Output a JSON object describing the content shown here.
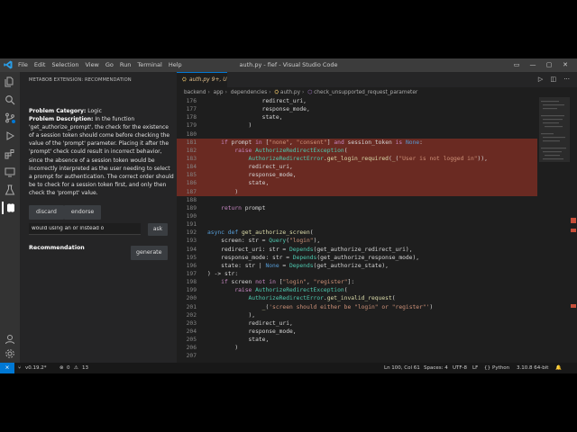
{
  "titlebar": {
    "menu": [
      "File",
      "Edit",
      "Selection",
      "View",
      "Go",
      "Run",
      "Terminal",
      "Help"
    ],
    "title": "auth.py - fief - Visual Studio Code"
  },
  "sidebar": {
    "header": "METABOB EXTENSION: RECOMMENDATION",
    "category_label": "Problem Category:",
    "category_value": "Logic",
    "description_label": "Problem Description:",
    "description_text": "In the function 'get_authorize_prompt', the check for the existence of a session token should come before checking the value of the 'prompt' parameter. Placing it after the 'prompt' check could result in incorrect behavior, since the absence of a session token would be incorrectly interpreted as the user needing to select a prompt for authentication. The correct order should be to check for a session token first, and only then check the 'prompt' value.",
    "discard_label": "discard",
    "endorse_label": "endorse",
    "ask_input_value": "would using an or instead o",
    "ask_label": "ask",
    "recommendation_label": "Recommendation",
    "generate_label": "generate"
  },
  "editor": {
    "tab": {
      "icon": "py-file-icon",
      "label": "auth.py",
      "status": "9+, U"
    },
    "breadcrumb": [
      "backend",
      "app",
      "dependencies",
      "auth.py",
      "check_unsupported_request_parameter"
    ],
    "lines": [
      {
        "n": "176",
        "t": "                redirect_uri,",
        "hl": false
      },
      {
        "n": "177",
        "t": "                response_mode,",
        "hl": false
      },
      {
        "n": "178",
        "t": "                state,",
        "hl": false
      },
      {
        "n": "179",
        "t": "            )",
        "hl": false
      },
      {
        "n": "180",
        "t": "",
        "hl": false
      },
      {
        "n": "181",
        "t": "    if prompt in [\"none\", \"consent\"] and session_token is None:",
        "hl": true
      },
      {
        "n": "182",
        "t": "        raise AuthorizeRedirectException(",
        "hl": true
      },
      {
        "n": "183",
        "t": "            AuthorizeRedirectError.get_login_required(_(\"User is not logged in\")),",
        "hl": true
      },
      {
        "n": "184",
        "t": "            redirect_uri,",
        "hl": true
      },
      {
        "n": "185",
        "t": "            response_mode,",
        "hl": true
      },
      {
        "n": "186",
        "t": "            state,",
        "hl": true
      },
      {
        "n": "187",
        "t": "        )",
        "hl": true
      },
      {
        "n": "188",
        "t": "",
        "hl": false
      },
      {
        "n": "189",
        "t": "    return prompt",
        "hl": false
      },
      {
        "n": "190",
        "t": "",
        "hl": false
      },
      {
        "n": "191",
        "t": "",
        "hl": false
      },
      {
        "n": "192",
        "t": "async def get_authorize_screen(",
        "hl": false
      },
      {
        "n": "193",
        "t": "    screen: str = Query(\"login\"),",
        "hl": false
      },
      {
        "n": "194",
        "t": "    redirect_uri: str = Depends(get_authorize_redirect_uri),",
        "hl": false
      },
      {
        "n": "195",
        "t": "    response_mode: str = Depends(get_authorize_response_mode),",
        "hl": false
      },
      {
        "n": "196",
        "t": "    state: str | None = Depends(get_authorize_state),",
        "hl": false
      },
      {
        "n": "197",
        "t": ") -> str:",
        "hl": false
      },
      {
        "n": "198",
        "t": "    if screen not in [\"login\", \"register\"]:",
        "hl": false
      },
      {
        "n": "199",
        "t": "        raise AuthorizeRedirectException(",
        "hl": false
      },
      {
        "n": "200",
        "t": "            AuthorizeRedirectError.get_invalid_request(",
        "hl": false
      },
      {
        "n": "201",
        "t": "                _('screen should either be \"login\" or \"register\"')",
        "hl": false
      },
      {
        "n": "202",
        "t": "            ),",
        "hl": false
      },
      {
        "n": "203",
        "t": "            redirect_uri,",
        "hl": false
      },
      {
        "n": "204",
        "t": "            response_mode,",
        "hl": false
      },
      {
        "n": "205",
        "t": "            state,",
        "hl": false
      },
      {
        "n": "206",
        "t": "        )",
        "hl": false
      },
      {
        "n": "207",
        "t": "",
        "hl": false
      }
    ]
  },
  "statusbar": {
    "branch": "v0.19.2*",
    "errors": "0",
    "warnings": "13",
    "cursor": "Ln 100, Col 61",
    "spaces": "Spaces: 4",
    "encoding": "UTF-8",
    "eol": "LF",
    "language": "Python",
    "interpreter": "3.10.8 64-bit"
  },
  "colors": {
    "accent": "#0078d4",
    "highlight": "#6a2a22",
    "sidebar_bg": "#252526",
    "editor_bg": "#1e1e1e"
  }
}
